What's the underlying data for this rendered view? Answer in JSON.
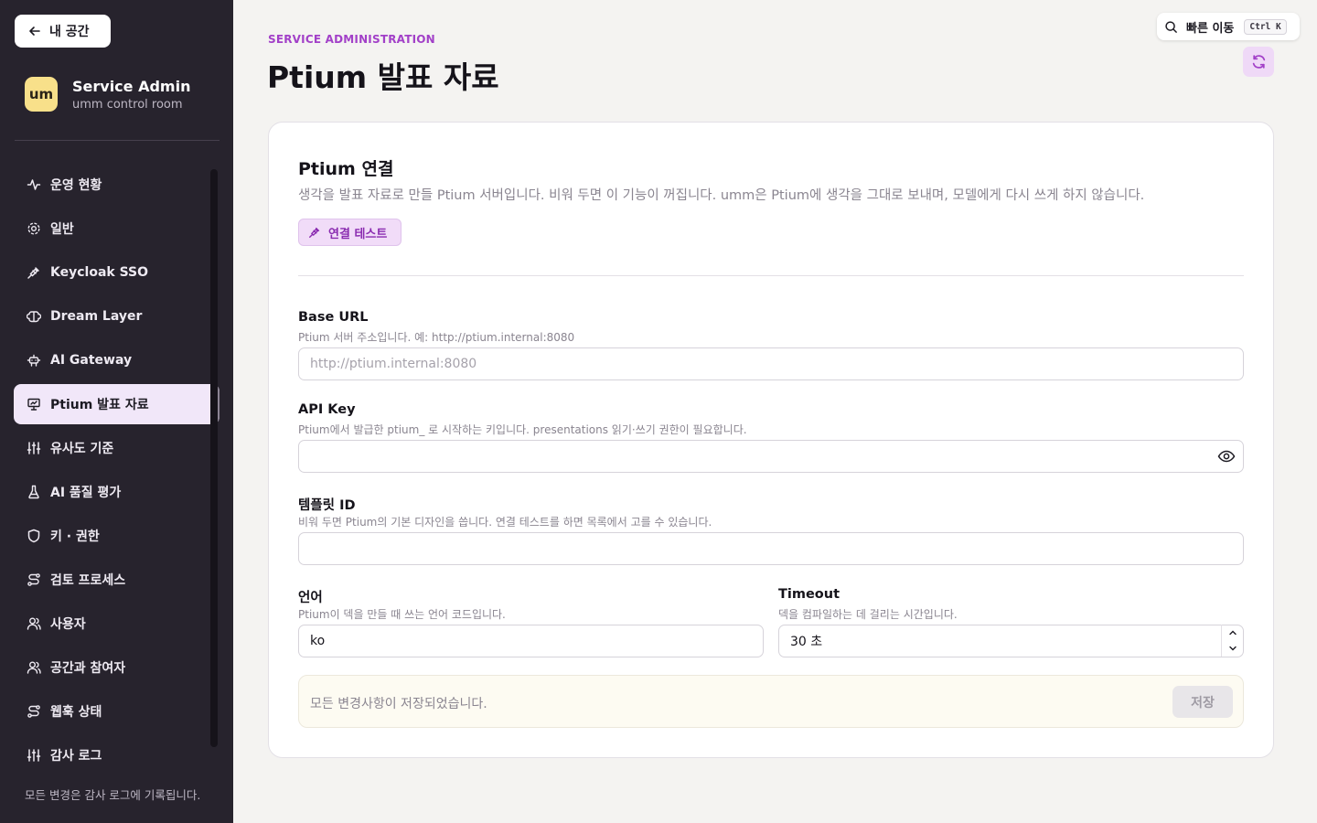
{
  "sidebar": {
    "back_label": "내 공간",
    "brand": {
      "logo": "um",
      "title": "Service Admin",
      "subtitle": "umm control room"
    },
    "items": [
      {
        "label": "운영 현황",
        "icon": "activity-icon",
        "active": false
      },
      {
        "label": "일반",
        "icon": "gear-icon",
        "active": false
      },
      {
        "label": "Keycloak SSO",
        "icon": "plug-icon",
        "active": false
      },
      {
        "label": "Dream Layer",
        "icon": "brain-icon",
        "active": false
      },
      {
        "label": "AI Gateway",
        "icon": "robot-icon",
        "active": false
      },
      {
        "label": "Ptium 발표 자료",
        "icon": "presentation-icon",
        "active": true
      },
      {
        "label": "유사도 기준",
        "icon": "sliders-icon",
        "active": false
      },
      {
        "label": "AI 품질 평가",
        "icon": "flask-icon",
        "active": false
      },
      {
        "label": "키 · 권한",
        "icon": "shield-icon",
        "active": false
      },
      {
        "label": "검토 프로세스",
        "icon": "route-icon",
        "active": false
      },
      {
        "label": "사용자",
        "icon": "user-icon",
        "active": false
      },
      {
        "label": "공간과 참여자",
        "icon": "users-icon",
        "active": false
      },
      {
        "label": "웹훅 상태",
        "icon": "webhook-icon",
        "active": false
      },
      {
        "label": "감사 로그",
        "icon": "sliders-icon",
        "active": false
      }
    ],
    "footer": "모든 변경은 감사 로그에 기록됩니다."
  },
  "header": {
    "eyebrow": "SERVICE ADMINISTRATION",
    "title": "Ptium 발표 자료",
    "quick_jump_label": "빠른 이동",
    "quick_jump_kbd": "Ctrl K"
  },
  "card": {
    "title": "Ptium 연결",
    "description": "생각을 발표 자료로 만들 Ptium 서버입니다. 비워 두면 이 기능이 꺼집니다. umm은 Ptium에 생각을 그대로 보내며, 모델에게 다시 쓰게 하지 않습니다.",
    "test_button": "연결 테스트",
    "fields": {
      "base_url": {
        "label": "Base URL",
        "help": "Ptium 서버 주소입니다. 예: http://ptium.internal:8080",
        "value": "",
        "placeholder": "http://ptium.internal:8080"
      },
      "api_key": {
        "label": "API Key",
        "help": "Ptium에서 발급한 ptium_ 로 시작하는 키입니다. presentations 읽기·쓰기 권한이 필요합니다.",
        "value": ""
      },
      "template_id": {
        "label": "템플릿 ID",
        "help": "비워 두면 Ptium의 기본 디자인을 씁니다. 연결 테스트를 하면 목록에서 고를 수 있습니다.",
        "value": ""
      },
      "language": {
        "label": "언어",
        "help": "Ptium이 덱을 만들 때 쓰는 언어 코드입니다.",
        "value": "ko"
      },
      "timeout": {
        "label": "Timeout",
        "help": "덱을 컴파일하는 데 걸리는 시간입니다.",
        "value": "30 초"
      }
    },
    "status": "모든 변경사항이 저장되었습니다.",
    "save_button": "저장"
  },
  "colors": {
    "accent": "#a240c8",
    "sidebar_bg": "#27232d",
    "active_item_bg": "#f1e7f9",
    "page_bg": "#f4f3f1"
  }
}
